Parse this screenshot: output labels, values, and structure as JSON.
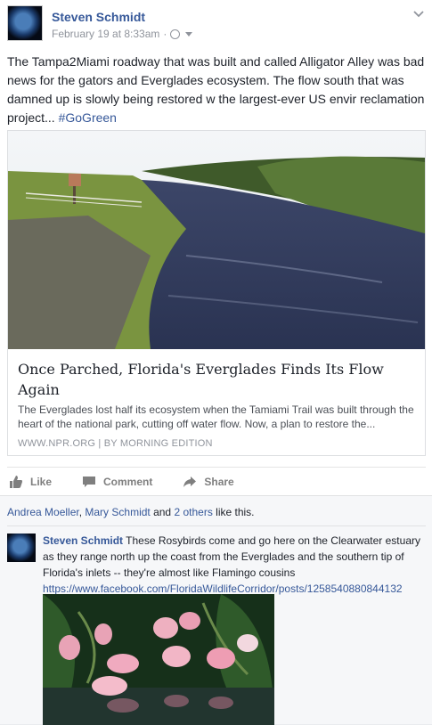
{
  "post": {
    "author": "Steven Schmidt",
    "timestamp": "February 19 at 8:33am",
    "dot": "·",
    "text": "The Tampa2Miami roadway that was built and called Alligator Alley was bad news for the gators and Everglades ecosystem. The flow south that was damned up is slowly being restored w the largest-ever US envir reclamation project... ",
    "hashtag": "#GoGreen"
  },
  "card": {
    "title": "Once Parched, Florida's Everglades Finds Its Flow Again",
    "description": "The Everglades lost half its ecosystem when the Tamiami Trail was built through the heart of the national park, cutting off water flow. Now, a plan to restore the...",
    "source": "WWW.NPR.ORG | BY MORNING EDITION"
  },
  "actions": {
    "like": "Like",
    "comment": "Comment",
    "share": "Share"
  },
  "likes": {
    "name1": "Andrea Moeller",
    "comma": ", ",
    "name2": "Mary Schmidt",
    "and": " and ",
    "others": "2 others",
    "suffix": " like this."
  },
  "comment": {
    "author": "Steven Schmidt",
    "text": " These Rosybirds come and go here on the Clearwater estuary as they range north up the coast from the Everglades and the southern tip of Florida's inlets -- they're almost like Flamingo cousins ",
    "link": "https://www.facebook.com/FloridaWildlifeCorridor/posts/1258540880844132"
  },
  "colors": {
    "link": "#365899",
    "muted": "#90949c",
    "feedback_bg": "#f6f7f9"
  },
  "icons": [
    "globe-icon",
    "caret-down-icon",
    "chevron-down-icon",
    "like-icon",
    "comment-icon",
    "share-icon"
  ]
}
